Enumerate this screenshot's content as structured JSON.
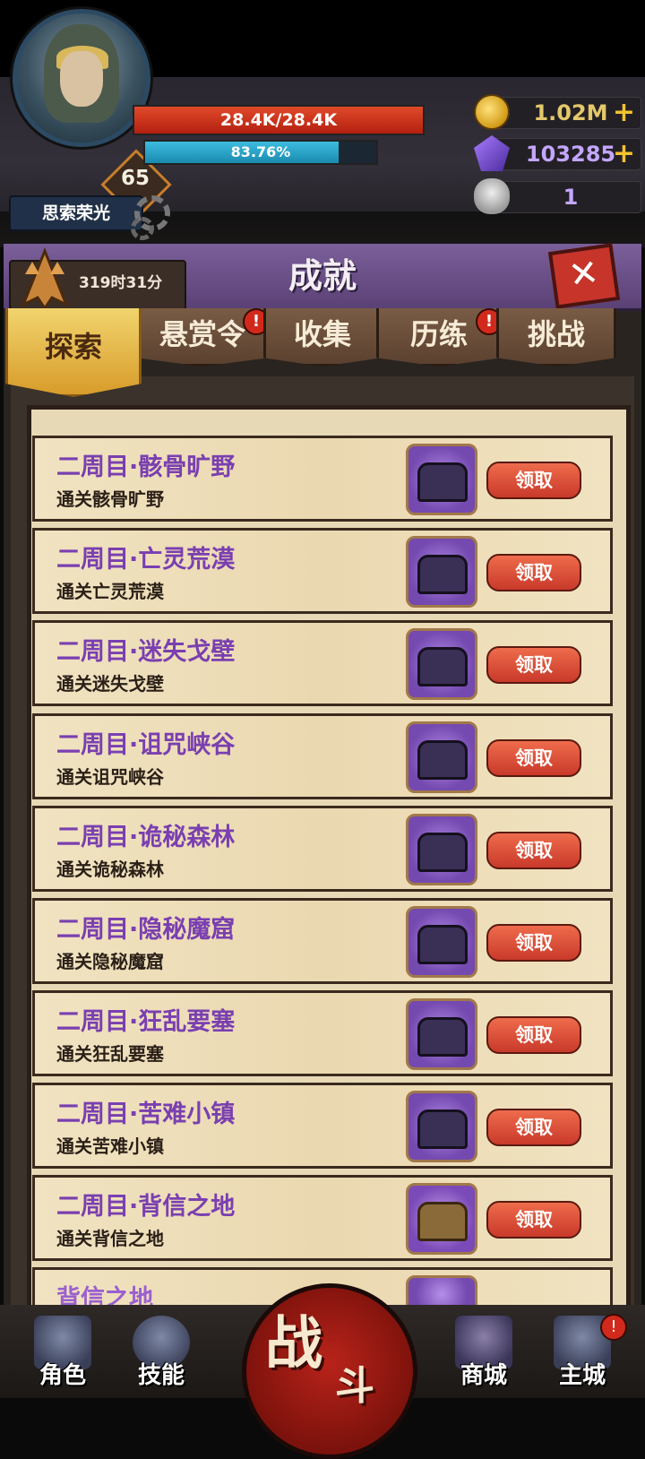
{
  "player": {
    "name": "思索荣光",
    "level": "65",
    "hp_text": "28.4K/28.4K",
    "xp_text": "83.76%",
    "xp_fraction": 0.8376
  },
  "currencies": {
    "gold": "1.02M",
    "gems": "103285",
    "tickets": "1",
    "plus": "+"
  },
  "panel": {
    "title": "成就",
    "timer": "319时31分",
    "close": "✕"
  },
  "tabs": [
    {
      "label": "探索",
      "active": true,
      "alert": false
    },
    {
      "label": "悬赏令",
      "active": false,
      "alert": true
    },
    {
      "label": "收集",
      "active": false,
      "alert": false
    },
    {
      "label": "历练",
      "active": false,
      "alert": true
    },
    {
      "label": "挑战",
      "active": false,
      "alert": false
    }
  ],
  "alert_mark": "!",
  "claim_label": "领取",
  "achievements": [
    {
      "title": "二周目·骸骨旷野",
      "desc": "通关骸骨旷野",
      "chest": "purple"
    },
    {
      "title": "二周目·亡灵荒漠",
      "desc": "通关亡灵荒漠",
      "chest": "purple"
    },
    {
      "title": "二周目·迷失戈壁",
      "desc": "通关迷失戈壁",
      "chest": "purple"
    },
    {
      "title": "二周目·诅咒峡谷",
      "desc": "通关诅咒峡谷",
      "chest": "purple"
    },
    {
      "title": "二周目·诡秘森林",
      "desc": "通关诡秘森林",
      "chest": "purple"
    },
    {
      "title": "二周目·隐秘魔窟",
      "desc": "通关隐秘魔窟",
      "chest": "purple"
    },
    {
      "title": "二周目·狂乱要塞",
      "desc": "通关狂乱要塞",
      "chest": "purple"
    },
    {
      "title": "二周目·苦难小镇",
      "desc": "通关苦难小镇",
      "chest": "purple"
    },
    {
      "title": "二周目·背信之地",
      "desc": "通关背信之地",
      "chest": "gold"
    },
    {
      "title": "背信之地",
      "desc": "",
      "chest": "purple"
    }
  ],
  "nav": {
    "role": "角色",
    "skill": "技能",
    "battle_1": "战",
    "battle_2": "斗",
    "shop": "商城",
    "city": "主城",
    "city_alert": "!"
  }
}
